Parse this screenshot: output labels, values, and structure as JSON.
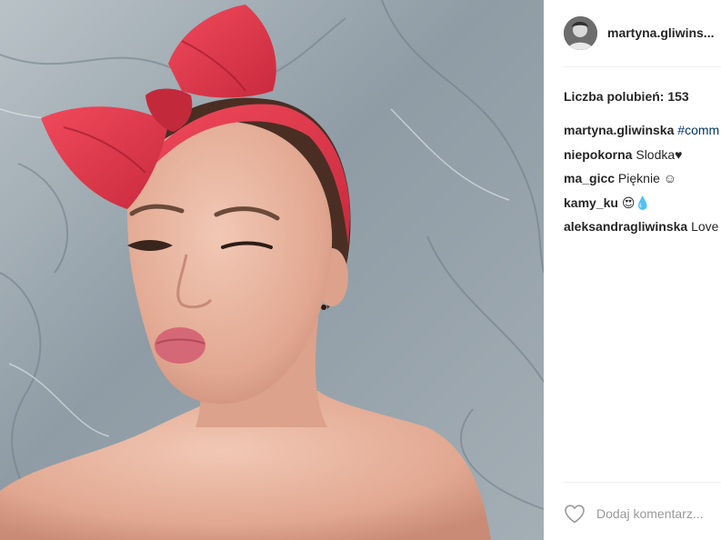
{
  "post": {
    "username": "martyna.gliwins...",
    "likes_text": "Liczba polubień: 153"
  },
  "comments": [
    {
      "author": "martyna.gliwinska",
      "text": " #comm",
      "is_hashtag": true
    },
    {
      "author": "niepokorna",
      "text": " Slodka♥"
    },
    {
      "author": "ma_gicc",
      "text": " Pięknie ☺"
    },
    {
      "author": "kamy_ku",
      "text": " 😍💧"
    },
    {
      "author": "aleksandragliwinska",
      "text": " Love"
    }
  ],
  "footer": {
    "comment_placeholder": "Dodaj komentarz..."
  },
  "icons": {
    "like": "heart-outline-icon",
    "avatar": "profile-avatar"
  },
  "colors": {
    "bow_red": "#e53a4c",
    "text": "#262626",
    "hashtag": "#003569",
    "divider": "#efefef"
  }
}
